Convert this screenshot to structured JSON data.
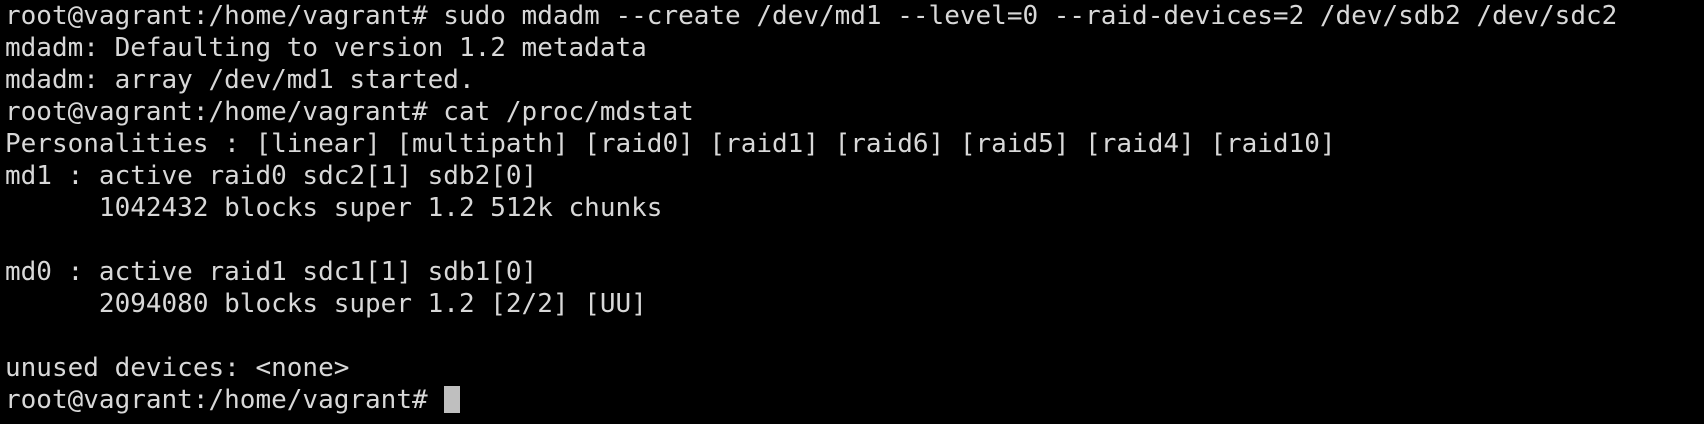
{
  "terminal": {
    "lines": [
      "root@vagrant:/home/vagrant# sudo mdadm --create /dev/md1 --level=0 --raid-devices=2 /dev/sdb2 /dev/sdc2",
      "mdadm: Defaulting to version 1.2 metadata",
      "mdadm: array /dev/md1 started.",
      "root@vagrant:/home/vagrant# cat /proc/mdstat",
      "Personalities : [linear] [multipath] [raid0] [raid1] [raid6] [raid5] [raid4] [raid10]",
      "md1 : active raid0 sdc2[1] sdb2[0]",
      "      1042432 blocks super 1.2 512k chunks",
      "",
      "md0 : active raid1 sdc1[1] sdb1[0]",
      "      2094080 blocks super 1.2 [2/2] [UU]",
      "",
      "unused devices: <none>"
    ],
    "prompt": "root@vagrant:/home/vagrant# ",
    "colors": {
      "background": "#000000",
      "foreground": "#d8d8d8",
      "cursor": "#bfbfbf"
    }
  }
}
